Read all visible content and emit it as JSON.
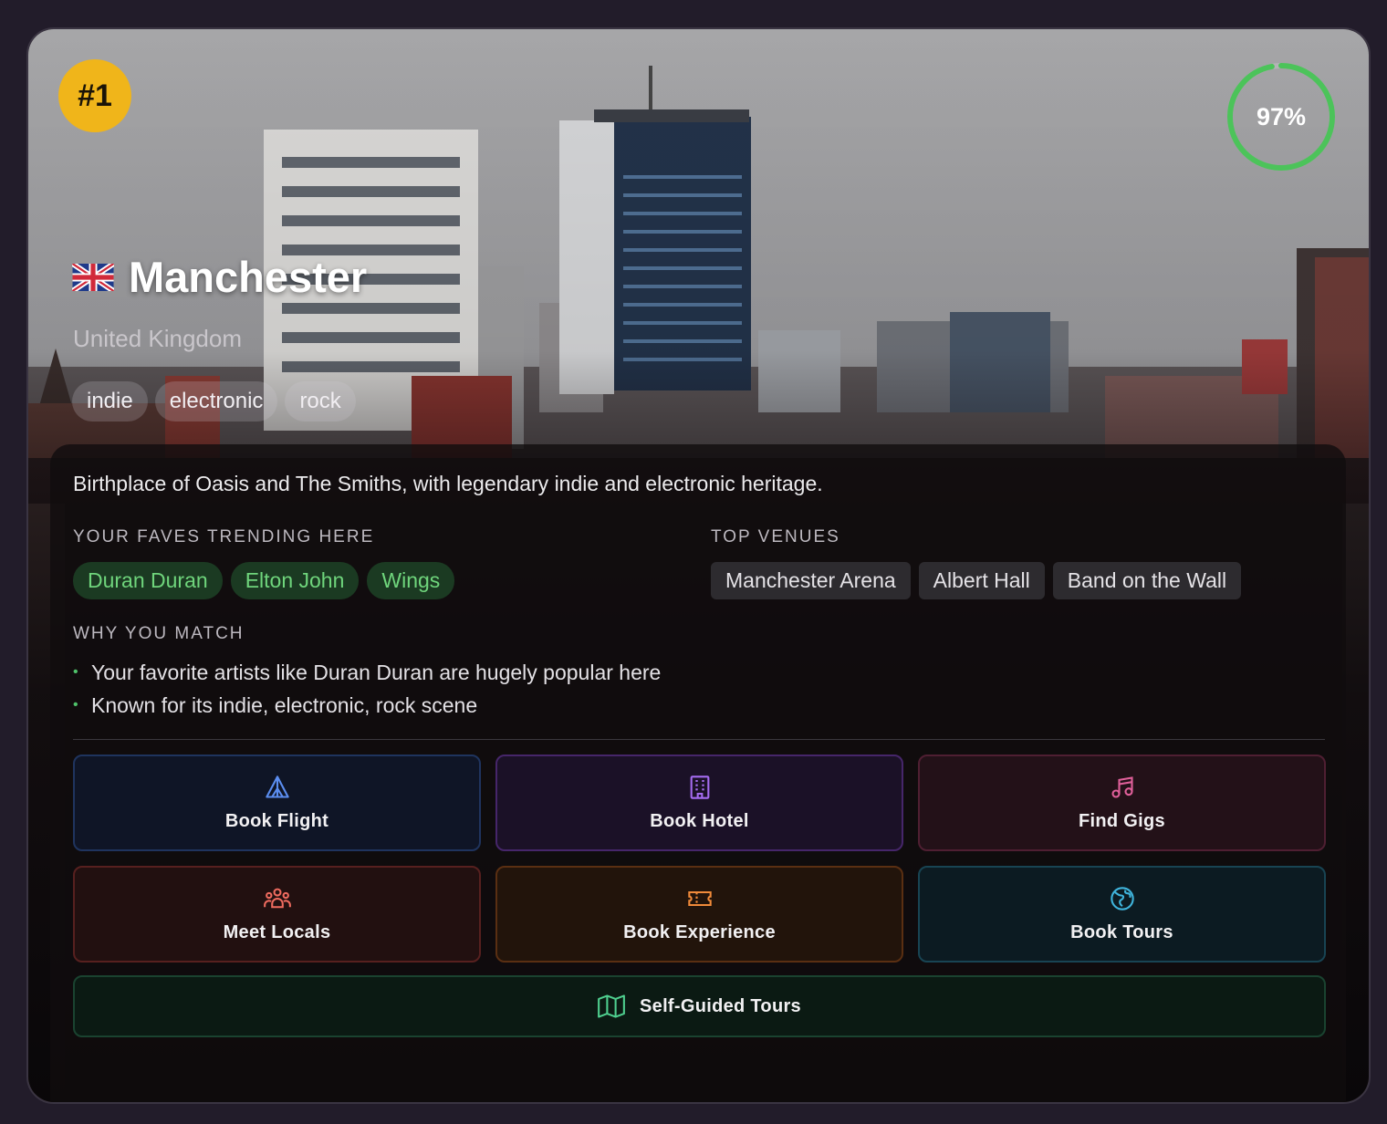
{
  "rank": "#1",
  "match_score": {
    "percent": 97,
    "label": "97%",
    "color": "#4cc35a"
  },
  "city": {
    "name": "Manchester",
    "country": "United Kingdom",
    "flag": "uk-flag"
  },
  "genres": [
    "indie",
    "electronic",
    "rock"
  ],
  "description": "Birthplace of Oasis and The Smiths, with legendary indie and electronic heritage.",
  "faves": {
    "label": "YOUR FAVES TRENDING HERE",
    "artists": [
      "Duran Duran",
      "Elton John",
      "Wings"
    ]
  },
  "venues": {
    "label": "TOP VENUES",
    "items": [
      "Manchester Arena",
      "Albert Hall",
      "Band on the Wall"
    ]
  },
  "why": {
    "label": "WHY YOU MATCH",
    "reasons": [
      "Your favorite artists like Duran Duran are hugely popular here",
      "Known for its indie, electronic, rock scene"
    ]
  },
  "actions": [
    {
      "label": "Book Flight",
      "icon": "plane-icon",
      "color": "#5b8def"
    },
    {
      "label": "Book Hotel",
      "icon": "hotel-icon",
      "color": "#a56cf0"
    },
    {
      "label": "Find Gigs",
      "icon": "music-note-icon",
      "color": "#e0609a"
    },
    {
      "label": "Meet Locals",
      "icon": "users-icon",
      "color": "#ef6b5f"
    },
    {
      "label": "Book Experience",
      "icon": "ticket-icon",
      "color": "#f08a3a"
    },
    {
      "label": "Book Tours",
      "icon": "globe-icon",
      "color": "#3fb4dc"
    }
  ],
  "self_guided": {
    "label": "Self-Guided Tours",
    "icon": "map-icon",
    "color": "#4fcf8f"
  }
}
